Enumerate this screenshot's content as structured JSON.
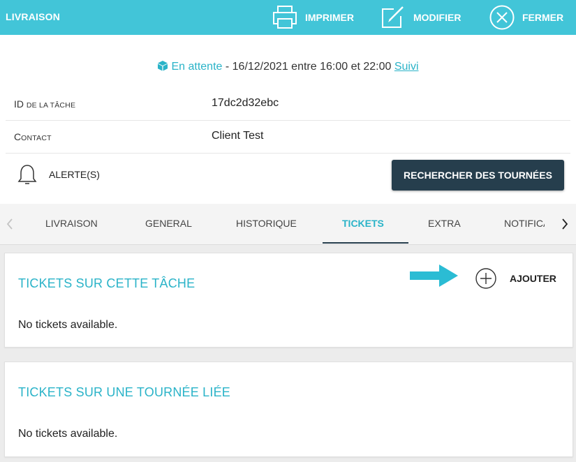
{
  "header": {
    "title": "LIVRAISON",
    "print_label": "IMPRIMER",
    "edit_label": "MODIFIER",
    "close_label": "FERMER"
  },
  "status": {
    "state": "En attente",
    "separator": " - ",
    "date_text": "16/12/2021 entre 16:00 et 22:00",
    "follow_link": "Suivi"
  },
  "fields": {
    "task_id": {
      "label_initial": "ID",
      "label_rest": "DE LA TÂCHE",
      "value": "17dc2d32ebc"
    },
    "contact": {
      "label_initial": "C",
      "label_rest": "ONTACT",
      "value": "Client Test"
    }
  },
  "alerts": {
    "label": "ALERTE(S)",
    "search_button": "RECHERCHER DES TOURNÉES"
  },
  "tabs": [
    {
      "label": "LIVRAISON"
    },
    {
      "label": "GENERAL"
    },
    {
      "label": "HISTORIQUE"
    },
    {
      "label": "TICKETS"
    },
    {
      "label": "EXTRA"
    },
    {
      "label": "NOTIFICATIONS"
    }
  ],
  "tickets_task": {
    "title": "TICKETS SUR CETTE TÂCHE",
    "add_label": "AJOUTER",
    "empty_text": "No tickets available."
  },
  "tickets_route": {
    "title": "TICKETS SUR UNE TOURNÉE LIÉE",
    "empty_text": "No tickets available."
  },
  "colors": {
    "header_bg": "#42c5d8",
    "accent": "#2ab3c8",
    "dark_button": "#263e4d"
  }
}
